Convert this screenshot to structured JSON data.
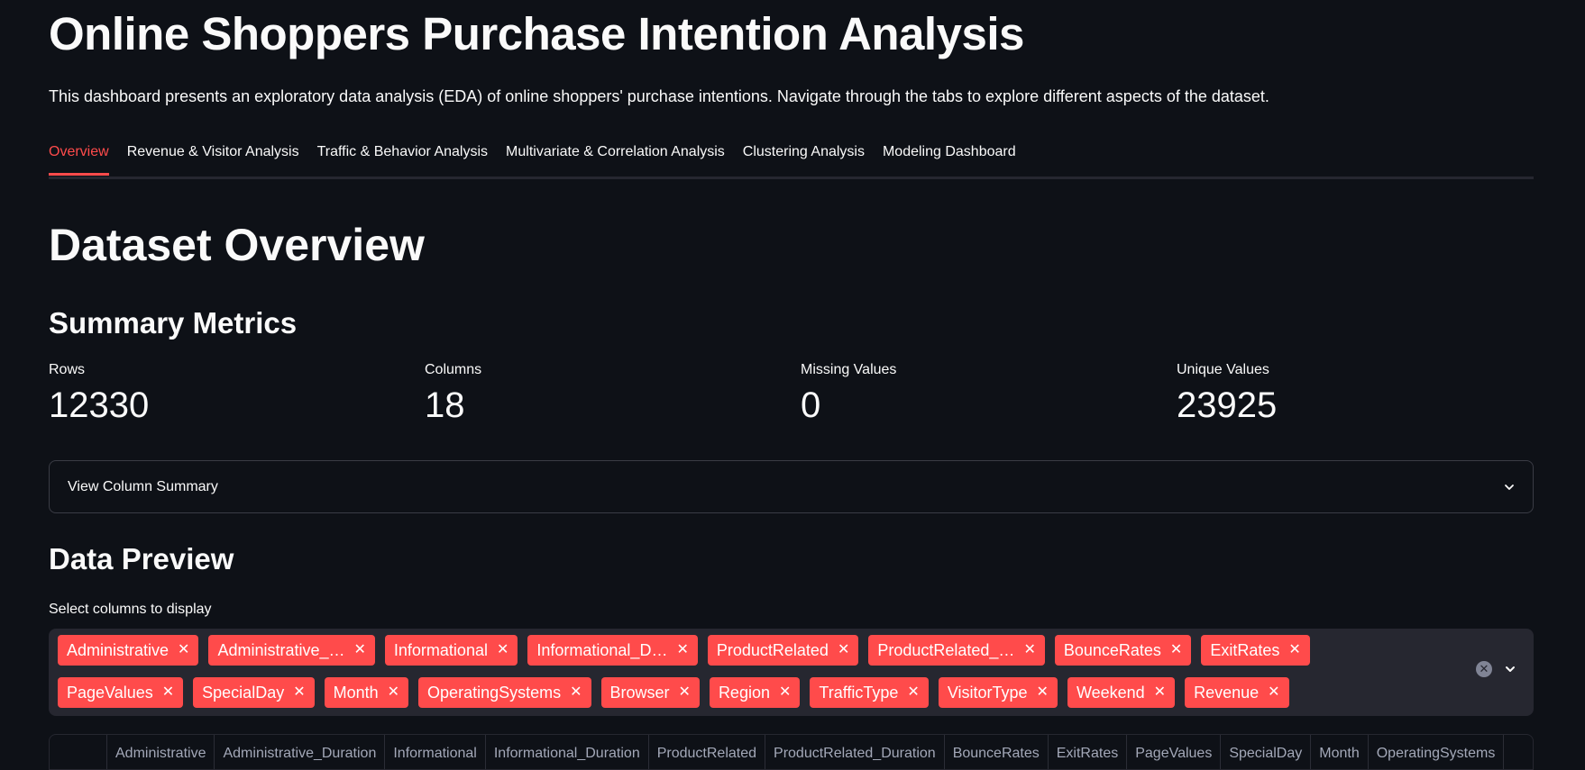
{
  "header": {
    "title": "Online Shoppers Purchase Intention Analysis",
    "intro": "This dashboard presents an exploratory data analysis (EDA) of online shoppers' purchase intentions. Navigate through the tabs to explore different aspects of the dataset."
  },
  "tabs": [
    {
      "label": "Overview",
      "active": true
    },
    {
      "label": "Revenue & Visitor Analysis",
      "active": false
    },
    {
      "label": "Traffic & Behavior Analysis",
      "active": false
    },
    {
      "label": "Multivariate & Correlation Analysis",
      "active": false
    },
    {
      "label": "Clustering Analysis",
      "active": false
    },
    {
      "label": "Modeling Dashboard",
      "active": false
    }
  ],
  "overview": {
    "title": "Dataset Overview",
    "summary_title": "Summary Metrics",
    "metrics": [
      {
        "label": "Rows",
        "value": "12330"
      },
      {
        "label": "Columns",
        "value": "18"
      },
      {
        "label": "Missing Values",
        "value": "0"
      },
      {
        "label": "Unique Values",
        "value": "23925"
      }
    ],
    "expander_label": "View Column Summary",
    "preview_title": "Data Preview",
    "select_label": "Select columns to display",
    "selected_tags_row1": [
      "Administrative",
      "Administrative_…",
      "Informational",
      "Informational_D…",
      "ProductRelated",
      "ProductRelated_…",
      "BounceRates",
      "ExitRates"
    ],
    "selected_tags_row2": [
      "PageValues",
      "SpecialDay",
      "Month",
      "OperatingSystems",
      "Browser",
      "Region",
      "TrafficType",
      "VisitorType",
      "Weekend",
      "Revenue"
    ],
    "table_headers": [
      "Administrative",
      "Administrative_Duration",
      "Informational",
      "Informational_Duration",
      "ProductRelated",
      "ProductRelated_Duration",
      "BounceRates",
      "ExitRates",
      "PageValues",
      "SpecialDay",
      "Month",
      "OperatingSystems"
    ]
  },
  "colors": {
    "accent": "#ff4b4b",
    "background": "#0e1117",
    "input_bg": "#262730"
  },
  "icons": {
    "expander": "chevron-down-icon",
    "clear": "clear-icon",
    "tag_remove": "close-icon"
  }
}
